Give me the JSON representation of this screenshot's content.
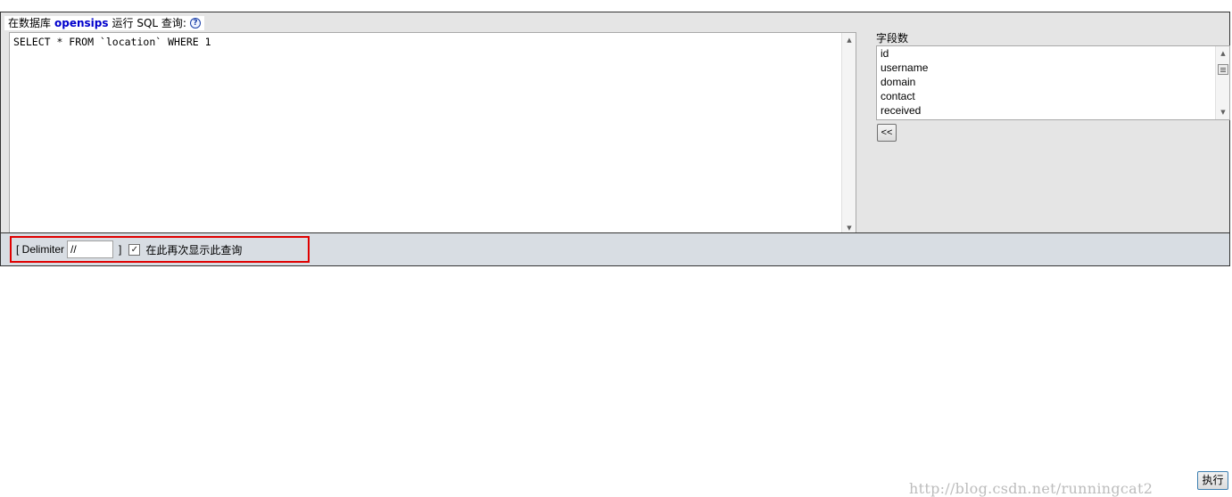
{
  "header": {
    "prefix": "在数据库",
    "database": "opensips",
    "suffix": "运行 SQL 查询:",
    "help_icon": "?"
  },
  "editor": {
    "query": "SELECT * FROM `location` WHERE 1",
    "scroll_up_icon": "▲",
    "scroll_down_icon": "▼"
  },
  "fields": {
    "label": "字段数",
    "items": [
      "id",
      "username",
      "domain",
      "contact",
      "received"
    ],
    "insert_button": "<<",
    "scroll_up_icon": "▲",
    "scroll_down_icon": "▼"
  },
  "footer": {
    "delimiter_open": "[ Delimiter",
    "delimiter_value": "//",
    "delimiter_close": "]",
    "checkbox_checked": true,
    "checkbox_mark": "✓",
    "show_query_label": "在此再次显示此查询",
    "go_button": "执行",
    "highlight_color": "#e00000"
  },
  "watermark": "http://blog.csdn.net/runningcat2"
}
